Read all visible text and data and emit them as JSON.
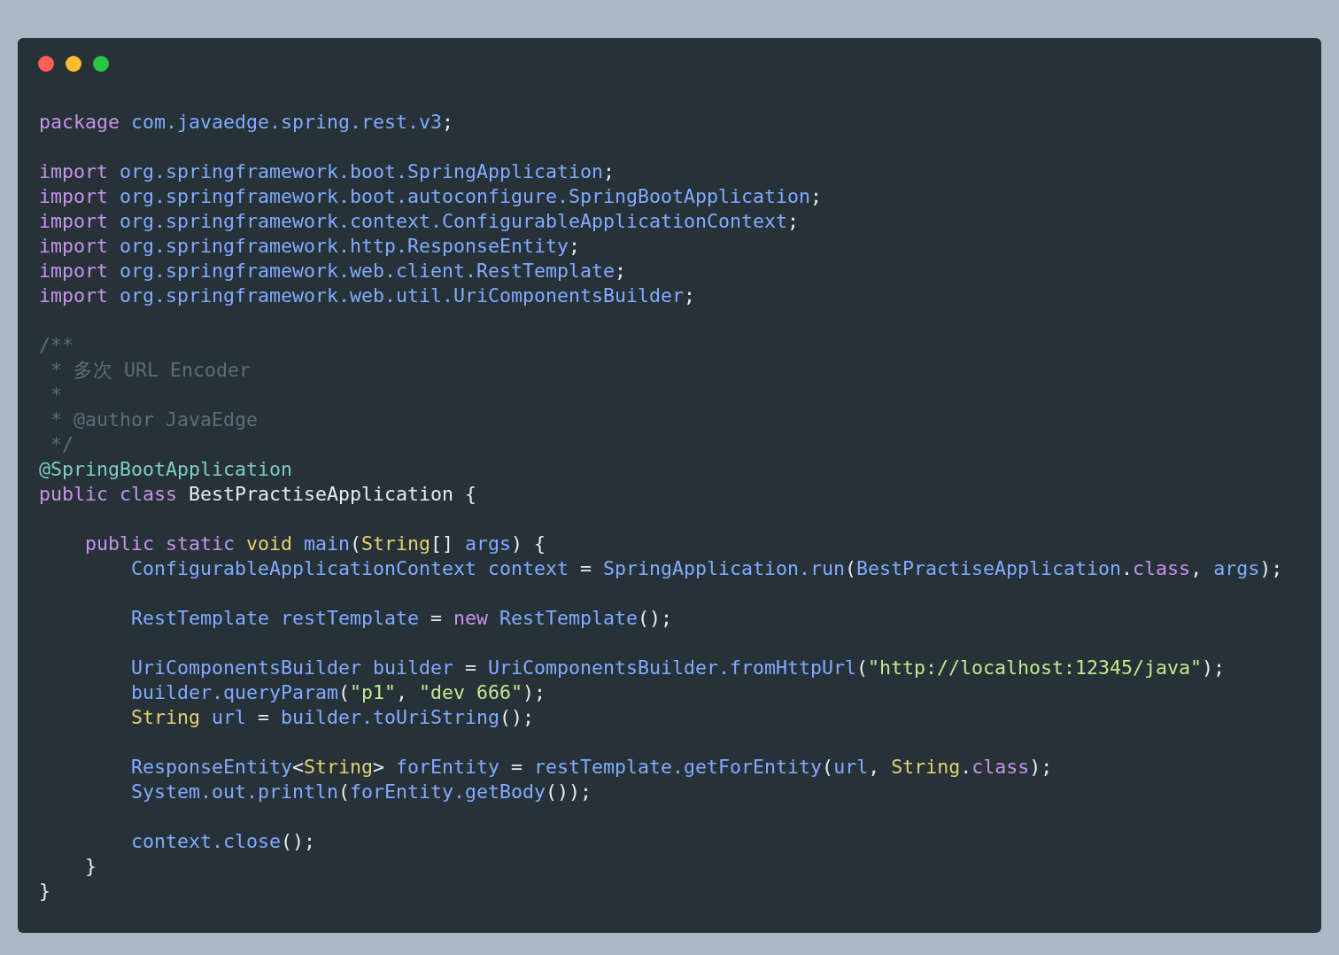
{
  "window_controls": [
    {
      "color": "#fe5f57"
    },
    {
      "color": "#febc2e"
    },
    {
      "color": "#28c840"
    }
  ],
  "lines": [
    {
      "kind": "code",
      "tokens": [
        {
          "text": "package",
          "kind": "keyword"
        },
        {
          "text": " com.javaedge.spring.rest.v3",
          "kind": "ident"
        },
        {
          "text": ";",
          "kind": "plain"
        }
      ]
    },
    {
      "kind": "blank"
    },
    {
      "kind": "code",
      "tokens": [
        {
          "text": "import",
          "kind": "keyword"
        },
        {
          "text": " org.springframework.boot.SpringApplication",
          "kind": "ident"
        },
        {
          "text": ";",
          "kind": "plain"
        }
      ]
    },
    {
      "kind": "code",
      "tokens": [
        {
          "text": "import",
          "kind": "keyword"
        },
        {
          "text": " org.springframework.boot.autoconfigure.SpringBootApplication",
          "kind": "ident"
        },
        {
          "text": ";",
          "kind": "plain"
        }
      ]
    },
    {
      "kind": "code",
      "tokens": [
        {
          "text": "import",
          "kind": "keyword"
        },
        {
          "text": " org.springframework.context.ConfigurableApplicationContext",
          "kind": "ident"
        },
        {
          "text": ";",
          "kind": "plain"
        }
      ]
    },
    {
      "kind": "code",
      "tokens": [
        {
          "text": "import",
          "kind": "keyword"
        },
        {
          "text": " org.springframework.http.ResponseEntity",
          "kind": "ident"
        },
        {
          "text": ";",
          "kind": "plain"
        }
      ]
    },
    {
      "kind": "code",
      "tokens": [
        {
          "text": "import",
          "kind": "keyword"
        },
        {
          "text": " org.springframework.web.client.RestTemplate",
          "kind": "ident"
        },
        {
          "text": ";",
          "kind": "plain"
        }
      ]
    },
    {
      "kind": "code",
      "tokens": [
        {
          "text": "import",
          "kind": "keyword"
        },
        {
          "text": " org.springframework.web.util.UriComponentsBuilder",
          "kind": "ident"
        },
        {
          "text": ";",
          "kind": "plain"
        }
      ]
    },
    {
      "kind": "blank"
    },
    {
      "kind": "code",
      "tokens": [
        {
          "text": "/**",
          "kind": "comment"
        }
      ]
    },
    {
      "kind": "code",
      "tokens": [
        {
          "text": " * 多次 URL Encoder",
          "kind": "comment"
        }
      ]
    },
    {
      "kind": "code",
      "tokens": [
        {
          "text": " *",
          "kind": "comment"
        }
      ]
    },
    {
      "kind": "code",
      "tokens": [
        {
          "text": " * @author JavaEdge",
          "kind": "comment"
        }
      ]
    },
    {
      "kind": "code",
      "tokens": [
        {
          "text": " */",
          "kind": "comment"
        }
      ]
    },
    {
      "kind": "code",
      "tokens": [
        {
          "text": "@SpringBootApplication",
          "kind": "annotation"
        }
      ]
    },
    {
      "kind": "code",
      "tokens": [
        {
          "text": "public class",
          "kind": "keyword"
        },
        {
          "text": " BestPractiseApplication {",
          "kind": "plain"
        }
      ]
    },
    {
      "kind": "blank"
    },
    {
      "kind": "code",
      "tokens": [
        {
          "text": "    public static",
          "kind": "keyword"
        },
        {
          "text": " void",
          "kind": "type"
        },
        {
          "text": " main",
          "kind": "ident"
        },
        {
          "text": "(",
          "kind": "plain"
        },
        {
          "text": "String",
          "kind": "type"
        },
        {
          "text": "[] ",
          "kind": "plain"
        },
        {
          "text": "args",
          "kind": "ident"
        },
        {
          "text": ") {",
          "kind": "plain"
        }
      ]
    },
    {
      "kind": "code",
      "tokens": [
        {
          "text": "        ConfigurableApplicationContext context",
          "kind": "ident"
        },
        {
          "text": " = ",
          "kind": "plain"
        },
        {
          "text": "SpringApplication.run",
          "kind": "ident"
        },
        {
          "text": "(",
          "kind": "plain"
        },
        {
          "text": "BestPractiseApplication",
          "kind": "ident"
        },
        {
          "text": ".",
          "kind": "plain"
        },
        {
          "text": "class",
          "kind": "keyword"
        },
        {
          "text": ", ",
          "kind": "plain"
        },
        {
          "text": "args",
          "kind": "ident"
        },
        {
          "text": ");",
          "kind": "plain"
        }
      ]
    },
    {
      "kind": "blank"
    },
    {
      "kind": "code",
      "tokens": [
        {
          "text": "        RestTemplate restTemplate",
          "kind": "ident"
        },
        {
          "text": " = ",
          "kind": "plain"
        },
        {
          "text": "new",
          "kind": "keyword"
        },
        {
          "text": " RestTemplate",
          "kind": "ident"
        },
        {
          "text": "();",
          "kind": "plain"
        }
      ]
    },
    {
      "kind": "blank"
    },
    {
      "kind": "code",
      "tokens": [
        {
          "text": "        UriComponentsBuilder builder",
          "kind": "ident"
        },
        {
          "text": " = ",
          "kind": "plain"
        },
        {
          "text": "UriComponentsBuilder.fromHttpUrl",
          "kind": "ident"
        },
        {
          "text": "(",
          "kind": "plain"
        },
        {
          "text": "\"http://localhost:12345/java\"",
          "kind": "string"
        },
        {
          "text": ");",
          "kind": "plain"
        }
      ]
    },
    {
      "kind": "code",
      "tokens": [
        {
          "text": "        builder.queryParam",
          "kind": "ident"
        },
        {
          "text": "(",
          "kind": "plain"
        },
        {
          "text": "\"p1\"",
          "kind": "string"
        },
        {
          "text": ", ",
          "kind": "plain"
        },
        {
          "text": "\"dev 666\"",
          "kind": "string"
        },
        {
          "text": ");",
          "kind": "plain"
        }
      ]
    },
    {
      "kind": "code",
      "tokens": [
        {
          "text": "        String",
          "kind": "type"
        },
        {
          "text": " url",
          "kind": "ident"
        },
        {
          "text": " = ",
          "kind": "plain"
        },
        {
          "text": "builder.toUriString",
          "kind": "ident"
        },
        {
          "text": "();",
          "kind": "plain"
        }
      ]
    },
    {
      "kind": "blank"
    },
    {
      "kind": "code",
      "tokens": [
        {
          "text": "        ResponseEntity",
          "kind": "ident"
        },
        {
          "text": "<",
          "kind": "plain"
        },
        {
          "text": "String",
          "kind": "type"
        },
        {
          "text": "> ",
          "kind": "plain"
        },
        {
          "text": "forEntity",
          "kind": "ident"
        },
        {
          "text": " = ",
          "kind": "plain"
        },
        {
          "text": "restTemplate.getForEntity",
          "kind": "ident"
        },
        {
          "text": "(",
          "kind": "plain"
        },
        {
          "text": "url",
          "kind": "ident"
        },
        {
          "text": ", ",
          "kind": "plain"
        },
        {
          "text": "String",
          "kind": "type"
        },
        {
          "text": ".",
          "kind": "plain"
        },
        {
          "text": "class",
          "kind": "keyword"
        },
        {
          "text": ");",
          "kind": "plain"
        }
      ]
    },
    {
      "kind": "code",
      "tokens": [
        {
          "text": "        System.out.println",
          "kind": "ident"
        },
        {
          "text": "(",
          "kind": "plain"
        },
        {
          "text": "forEntity.getBody",
          "kind": "ident"
        },
        {
          "text": "());",
          "kind": "plain"
        }
      ]
    },
    {
      "kind": "blank"
    },
    {
      "kind": "code",
      "tokens": [
        {
          "text": "        context.close",
          "kind": "ident"
        },
        {
          "text": "();",
          "kind": "plain"
        }
      ]
    },
    {
      "kind": "code",
      "tokens": [
        {
          "text": "    }",
          "kind": "plain"
        }
      ]
    },
    {
      "kind": "code",
      "tokens": [
        {
          "text": "}",
          "kind": "plain"
        }
      ]
    }
  ]
}
